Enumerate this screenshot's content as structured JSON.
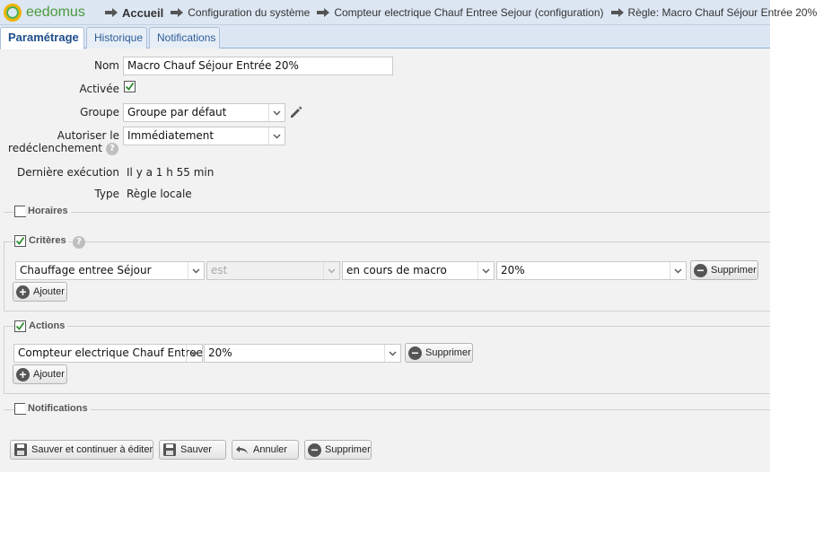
{
  "header": {
    "logo_text": "eedomus",
    "breadcrumbs": [
      "Accueil",
      "Configuration du système",
      "Compteur electrique Chauf Entree Sejour (configuration)",
      "Règle: Macro Chauf Séjour Entrée 20%"
    ]
  },
  "tabs": [
    "Paramétrage",
    "Historique",
    "Notifications"
  ],
  "form": {
    "nom_label": "Nom",
    "nom_value": "Macro Chauf Séjour Entrée 20%",
    "activee_label": "Activée",
    "activee_checked": true,
    "groupe_label": "Groupe",
    "groupe_value": "Groupe par défaut",
    "autoriser_label_1": "Autoriser le",
    "autoriser_label_2": "redéclenchement",
    "autoriser_value": "Immédiatement",
    "derniere_label": "Dernière exécution",
    "derniere_value": "Il y a 1 h 55 min",
    "type_label": "Type",
    "type_value": "Règle locale"
  },
  "sections": {
    "horaires": {
      "title": "Horaires",
      "checked": false
    },
    "criteres": {
      "title": "Critères",
      "checked": true,
      "row": {
        "device": "Chauffage entree Séjour",
        "operator": "est",
        "state": "en cours de macro",
        "value": "20%",
        "delete_label": "Supprimer"
      },
      "add_label": "Ajouter"
    },
    "actions": {
      "title": "Actions",
      "checked": true,
      "row": {
        "device": "Compteur electrique Chauf Entree Sejour",
        "value": "20%",
        "delete_label": "Supprimer"
      },
      "add_label": "Ajouter"
    },
    "notifications": {
      "title": "Notifications",
      "checked": false
    }
  },
  "footer": {
    "save_continue": "Sauver et continuer à éditer",
    "save": "Sauver",
    "cancel": "Annuler",
    "delete": "Supprimer"
  },
  "colors": {
    "header_bg": "#dde7f3",
    "tab_text": "#2a5d9a",
    "check_green": "#2e8b2e",
    "logo_green": "#4a9a3a",
    "logo_yellow": "#f0b400"
  }
}
